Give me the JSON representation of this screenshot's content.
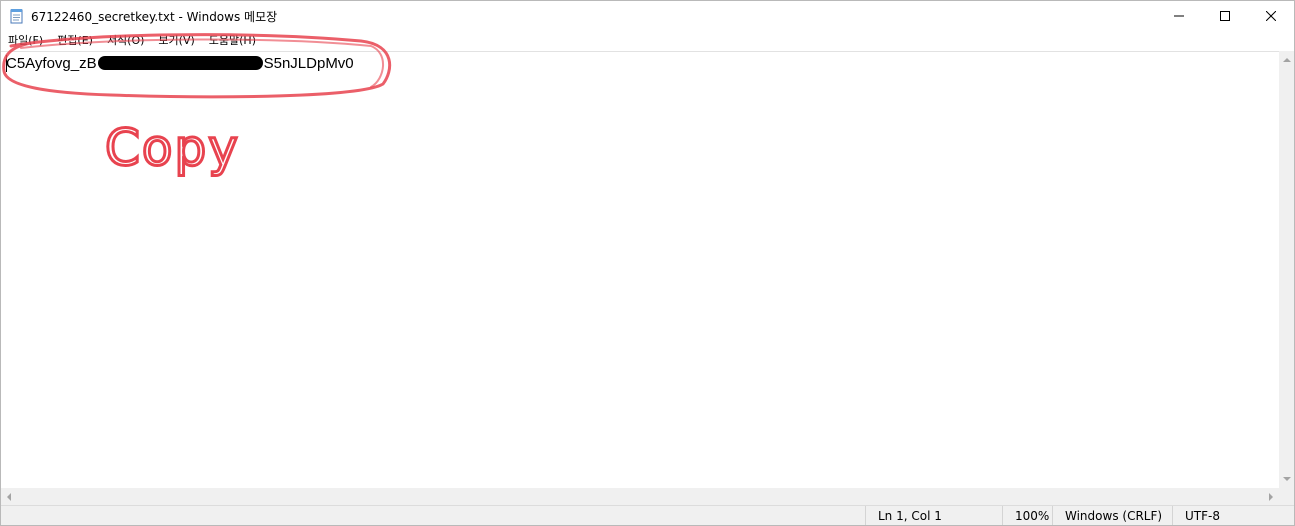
{
  "window": {
    "title": "67122460_secretkey.txt - Windows 메모장",
    "icon": "notepad-icon",
    "controls": {
      "minimize": "minimize-icon",
      "maximize": "maximize-icon",
      "close": "close-icon"
    }
  },
  "menu": {
    "items": [
      {
        "label": "파일(F)"
      },
      {
        "label": "편집(E)"
      },
      {
        "label": "서식(O)"
      },
      {
        "label": "보기(V)"
      },
      {
        "label": "도움말(H)"
      }
    ]
  },
  "editor": {
    "text_start": "C5Ayfovg_zB",
    "text_end": "S5nJLDpMv0"
  },
  "annotation": {
    "label": "Copy",
    "color": "#e8434f"
  },
  "statusbar": {
    "position": "Ln 1, Col 1",
    "zoom": "100%",
    "line_ending": "Windows (CRLF)",
    "encoding": "UTF-8"
  }
}
